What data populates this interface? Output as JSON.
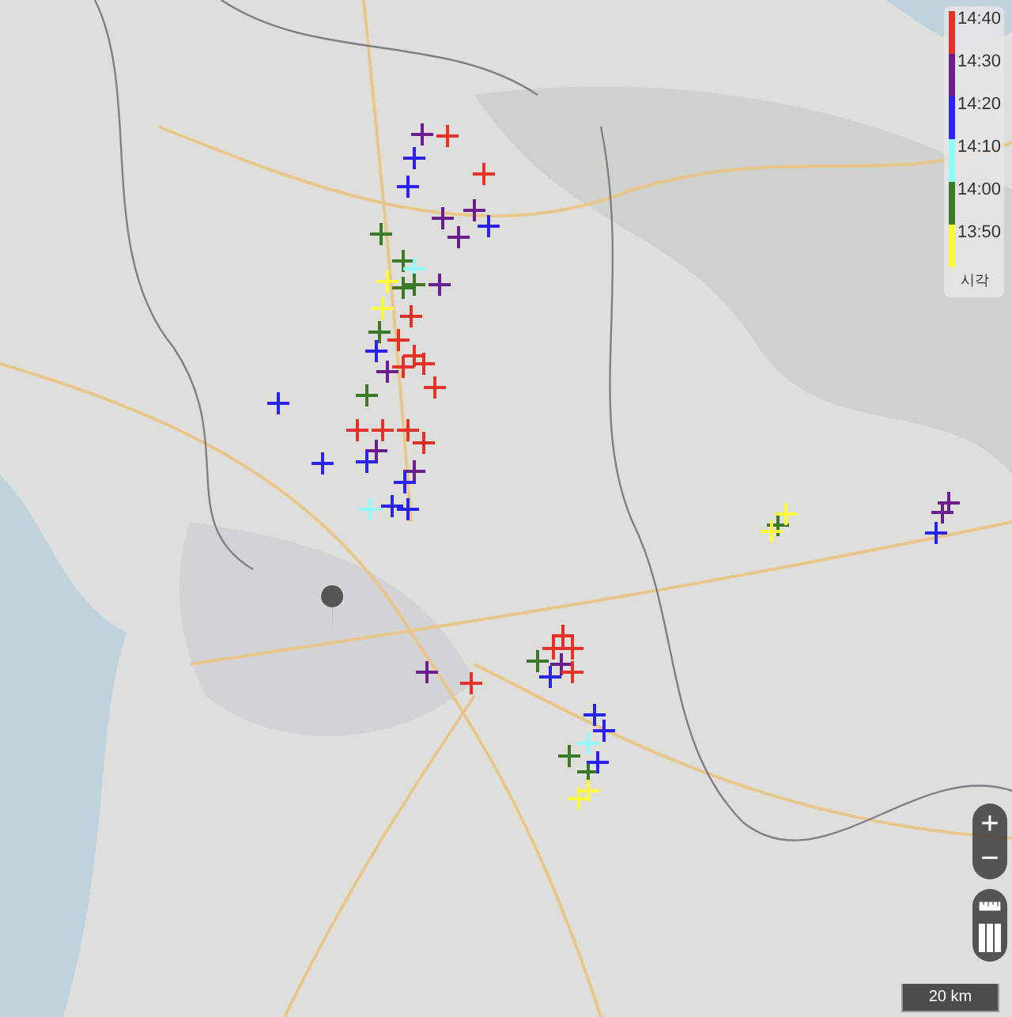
{
  "legend": {
    "entries": [
      {
        "label": "14:40",
        "color": "#e53127"
      },
      {
        "label": "14:30",
        "color": "#6b1f8c"
      },
      {
        "label": "14:20",
        "color": "#2a22f2"
      },
      {
        "label": "14:10",
        "color": "#8ffcfc"
      },
      {
        "label": "14:00",
        "color": "#3c7a27"
      },
      {
        "label": "13:50",
        "color": "#fbfb3c"
      }
    ],
    "title": "시각"
  },
  "zoom_controls": {
    "zoom_in": "+",
    "zoom_out": "−"
  },
  "scale_bar": {
    "label": "20 km"
  }
}
